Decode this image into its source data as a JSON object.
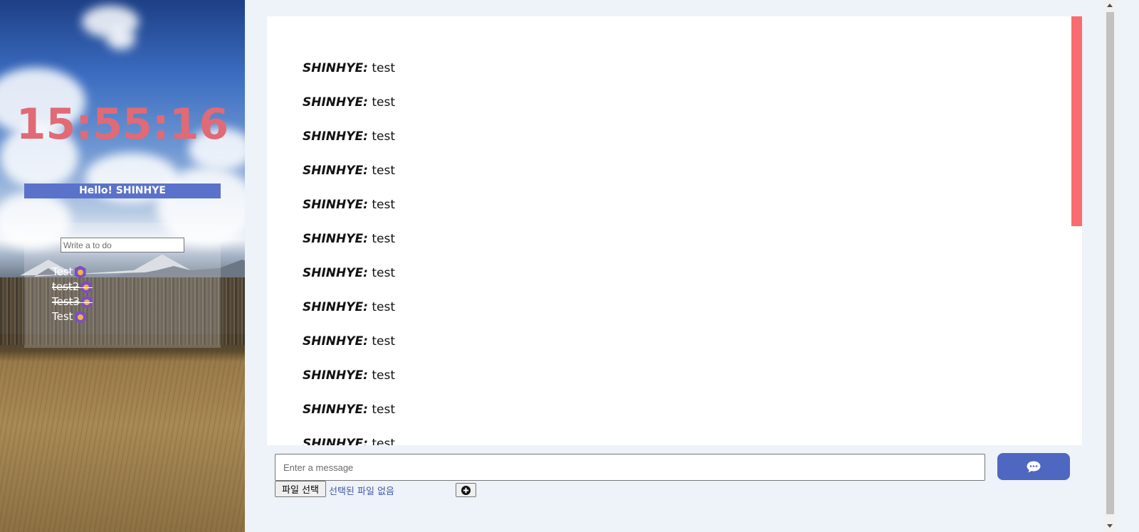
{
  "clock": {
    "time": "15:55:16"
  },
  "greeting": {
    "text": "Hello! SHINHYE"
  },
  "todo": {
    "placeholder": "Write a to do",
    "items": [
      {
        "text": "Test",
        "done": false,
        "icon": "lion-emoji-icon"
      },
      {
        "text": "test2",
        "done": true,
        "icon": "lion-emoji-icon"
      },
      {
        "text": "Test3",
        "done": true,
        "icon": "lion-emoji-icon"
      },
      {
        "text": "Test",
        "done": false,
        "icon": "lion-emoji-icon"
      }
    ]
  },
  "chat": {
    "messages": [
      {
        "author": "SHINHYE:",
        "text": "test"
      },
      {
        "author": "SHINHYE:",
        "text": "test"
      },
      {
        "author": "SHINHYE:",
        "text": "test"
      },
      {
        "author": "SHINHYE:",
        "text": "test"
      },
      {
        "author": "SHINHYE:",
        "text": "test"
      },
      {
        "author": "SHINHYE:",
        "text": "test"
      },
      {
        "author": "SHINHYE:",
        "text": "test"
      },
      {
        "author": "SHINHYE:",
        "text": "test"
      },
      {
        "author": "SHINHYE:",
        "text": "test"
      },
      {
        "author": "SHINHYE:",
        "text": "test"
      },
      {
        "author": "SHINHYE:",
        "text": "test"
      },
      {
        "author": "SHINHYE:",
        "text": "test"
      }
    ],
    "input_placeholder": "Enter a message",
    "send_icon": "chat-bubble-icon",
    "file_button_label": "파일 선택",
    "file_status": "선택된 파일 없음",
    "upload_icon": "plus-circle-icon"
  },
  "colors": {
    "clock": "#e06a76",
    "greeting_bg": "#5a72c9",
    "send_button": "#4e67c0",
    "scroll_indicator": "#f96b6e",
    "background": "#eef2f9"
  }
}
